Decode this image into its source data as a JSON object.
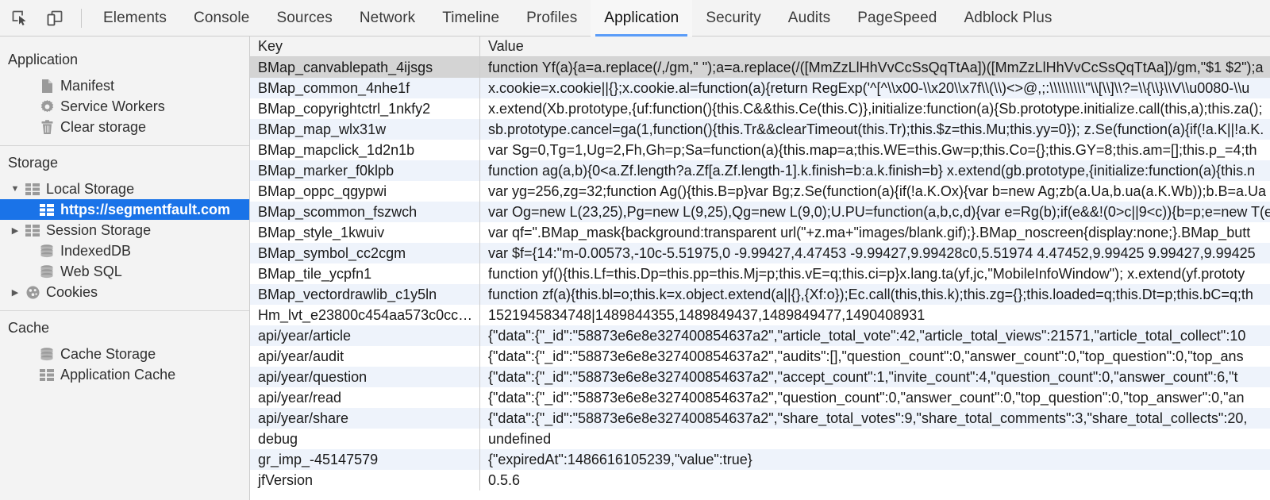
{
  "toolbar": {
    "icons": [
      {
        "name": "inspect-element-icon",
        "title": "Inspect element"
      },
      {
        "name": "device-toolbar-icon",
        "title": "Toggle device toolbar"
      }
    ],
    "tabs": [
      {
        "label": "Elements",
        "active": false
      },
      {
        "label": "Console",
        "active": false
      },
      {
        "label": "Sources",
        "active": false
      },
      {
        "label": "Network",
        "active": false
      },
      {
        "label": "Timeline",
        "active": false
      },
      {
        "label": "Profiles",
        "active": false
      },
      {
        "label": "Application",
        "active": true
      },
      {
        "label": "Security",
        "active": false
      },
      {
        "label": "Audits",
        "active": false
      },
      {
        "label": "PageSpeed",
        "active": false
      },
      {
        "label": "Adblock Plus",
        "active": false
      }
    ],
    "active_tab_underline_color": "#5a9cf8"
  },
  "sidebar": {
    "sections": [
      {
        "title": "Application",
        "items": [
          {
            "label": "Manifest",
            "icon": "document-icon",
            "arrow": "none",
            "level": 1,
            "selected": false
          },
          {
            "label": "Service Workers",
            "icon": "gear-icon",
            "arrow": "none",
            "level": 1,
            "selected": false
          },
          {
            "label": "Clear storage",
            "icon": "trash-icon",
            "arrow": "none",
            "level": 1,
            "selected": false
          }
        ]
      },
      {
        "title": "Storage",
        "items": [
          {
            "label": "Local Storage",
            "icon": "table-icon",
            "arrow": "expanded",
            "level": 1,
            "selected": false
          },
          {
            "label": "https://segmentfault.com",
            "icon": "table-icon",
            "arrow": "none",
            "level": 2,
            "selected": true
          },
          {
            "label": "Session Storage",
            "icon": "table-icon",
            "arrow": "collapsed",
            "level": 1,
            "selected": false
          },
          {
            "label": "IndexedDB",
            "icon": "database-icon",
            "arrow": "none",
            "level": 1,
            "selected": false
          },
          {
            "label": "Web SQL",
            "icon": "database-icon",
            "arrow": "none",
            "level": 1,
            "selected": false
          },
          {
            "label": "Cookies",
            "icon": "cookie-icon",
            "arrow": "collapsed",
            "level": 1,
            "selected": false
          }
        ]
      },
      {
        "title": "Cache",
        "items": [
          {
            "label": "Cache Storage",
            "icon": "database-icon",
            "arrow": "none",
            "level": 1,
            "selected": false
          },
          {
            "label": "Application Cache",
            "icon": "table-icon",
            "arrow": "none",
            "level": 1,
            "selected": false
          }
        ]
      }
    ],
    "selected_background_color": "#1a73e8"
  },
  "grid": {
    "columns": [
      "Key",
      "Value"
    ],
    "selected_row_index": 0,
    "rows": [
      {
        "key": "BMap_canvablepath_4ijsgs",
        "value": "function Yf(a){a=a.replace(/,/gm,\" \");a=a.replace(/([MmZzLlHhVvCcSsQqTtAa])([MmZzLlHhVvCcSsQqTtAa])/gm,\"$1 $2\");a"
      },
      {
        "key": "BMap_common_4nhe1f",
        "value": "x.cookie=x.cookie||{};x.cookie.al=function(a){return RegExp('^[^\\\\x00-\\\\x20\\\\x7f\\\\(\\\\)<>@,;:\\\\\\\\\\\\\\\\\\\"\\\\[\\\\]\\\\?=\\\\{\\\\}\\\\V\\\\u0080-\\\\u"
      },
      {
        "key": "BMap_copyrightctrl_1nkfy2",
        "value": "x.extend(Xb.prototype,{uf:function(){this.C&&this.Ce(this.C)},initialize:function(a){Sb.prototype.initialize.call(this,a);this.za();"
      },
      {
        "key": "BMap_map_wlx31w",
        "value": "sb.prototype.cancel=ga(1,function(){this.Tr&&clearTimeout(this.Tr);this.$z=this.Mu;this.yy=0}); z.Se(function(a){if(!a.K||!a.K."
      },
      {
        "key": "BMap_mapclick_1d2n1b",
        "value": "var Sg=0,Tg=1,Ug=2,Fh,Gh=p;Sa=function(a){this.map=a;this.WE=this.Gw=p;this.Co={};this.GY=8;this.am=[];this.p_=4;th"
      },
      {
        "key": "BMap_marker_f0klpb",
        "value": "function ag(a,b){0<a.Zf.length?a.Zf[a.Zf.length-1].k.finish=b:a.k.finish=b} x.extend(gb.prototype,{initialize:function(a){this.n"
      },
      {
        "key": "BMap_oppc_qgypwi",
        "value": "var yg=256,zg=32;function Ag(){this.B=p}var Bg;z.Se(function(a){if(!a.K.Ox){var b=new Ag;zb(a.Ua,b.ua(a.K.Wb));b.B=a.Ua"
      },
      {
        "key": "BMap_scommon_fszwch",
        "value": "var Og=new L(23,25),Pg=new L(9,25),Qg=new L(9,0);U.PU=function(a,b,c,d){var e=Rg(b);if(e&&!(0>c||9<c)){b=p;e=new T(e"
      },
      {
        "key": "BMap_style_1kwuiv",
        "value": "var qf=\".BMap_mask{background:transparent url(\"+z.ma+\"images/blank.gif);}.BMap_noscreen{display:none;}.BMap_butt"
      },
      {
        "key": "BMap_symbol_cc2cgm",
        "value": "var $f={14:\"m-0.00573,-10c-5.51975,0 -9.99427,4.47453 -9.99427,9.99428c0,5.51974 4.47452,9.99425 9.99427,9.99425"
      },
      {
        "key": "BMap_tile_ycpfn1",
        "value": "function yf(){this.Lf=this.Dp=this.pp=this.Mj=p;this.vE=q;this.ci=p}x.lang.ta(yf,jc,\"MobileInfoWindow\"); x.extend(yf.prototy"
      },
      {
        "key": "BMap_vectordrawlib_c1y5ln",
        "value": "function zf(a){this.bl=o;this.k=x.object.extend(a||{},{Xf:o});Ec.call(this,this.k);this.zg={};this.loaded=q;this.Dt=p;this.bC=q;th"
      },
      {
        "key": "Hm_lvt_e23800c454aa573c0cc…",
        "value": "1521945834748|1489844355,1489849437,1489849477,1490408931"
      },
      {
        "key": "api/year/article",
        "value": "{\"data\":{\"_id\":\"58873e6e8e327400854637a2\",\"article_total_vote\":42,\"article_total_views\":21571,\"article_total_collect\":10"
      },
      {
        "key": "api/year/audit",
        "value": "{\"data\":{\"_id\":\"58873e6e8e327400854637a2\",\"audits\":[],\"question_count\":0,\"answer_count\":0,\"top_question\":0,\"top_ans"
      },
      {
        "key": "api/year/question",
        "value": "{\"data\":{\"_id\":\"58873e6e8e327400854637a2\",\"accept_count\":1,\"invite_count\":4,\"question_count\":0,\"answer_count\":6,\"t"
      },
      {
        "key": "api/year/read",
        "value": "{\"data\":{\"_id\":\"58873e6e8e327400854637a2\",\"question_count\":0,\"answer_count\":0,\"top_question\":0,\"top_answer\":0,\"an"
      },
      {
        "key": "api/year/share",
        "value": "{\"data\":{\"_id\":\"58873e6e8e327400854637a2\",\"share_total_votes\":9,\"share_total_comments\":3,\"share_total_collects\":20,"
      },
      {
        "key": "debug",
        "value": "undefined"
      },
      {
        "key": "gr_imp_-45147579",
        "value": "{\"expiredAt\":1486616105239,\"value\":true}"
      },
      {
        "key": "jfVersion",
        "value": "0.5.6"
      }
    ]
  }
}
